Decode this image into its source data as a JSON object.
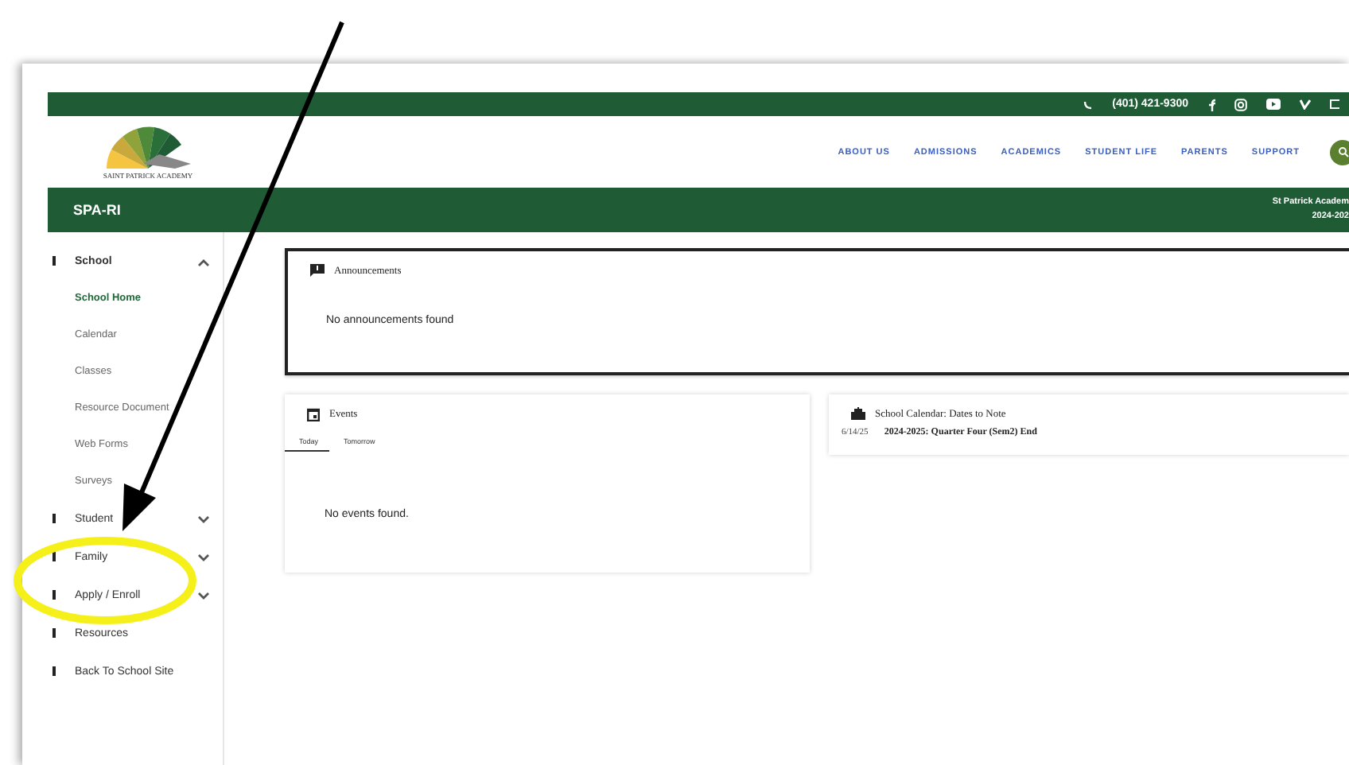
{
  "top_bar": {
    "phone": "(401) 421-9300"
  },
  "header": {
    "logo_text": "SAINT PATRICK ACADEMY",
    "nav": [
      "ABOUT US",
      "ADMISSIONS",
      "ACADEMICS",
      "STUDENT LIFE",
      "PARENTS",
      "SUPPORT"
    ]
  },
  "title_bar": {
    "title": "SPA-RI",
    "school": "St Patrick Academ",
    "year": "2024-202"
  },
  "sidebar": {
    "items": [
      {
        "label": "School",
        "kind": "section",
        "expanded": true,
        "children": [
          {
            "label": "School Home",
            "selected": true
          },
          {
            "label": "Calendar",
            "selected": false
          },
          {
            "label": "Classes",
            "selected": false
          },
          {
            "label": "Resource Document",
            "selected": false
          },
          {
            "label": "Web Forms",
            "selected": false
          },
          {
            "label": "Surveys",
            "selected": false
          }
        ]
      },
      {
        "label": "Student",
        "kind": "section",
        "expanded": false
      },
      {
        "label": "Family",
        "kind": "section",
        "expanded": false
      },
      {
        "label": "Apply / Enroll",
        "kind": "section",
        "expanded": false
      },
      {
        "label": "Resources",
        "kind": "link"
      },
      {
        "label": "Back To School Site",
        "kind": "link"
      }
    ]
  },
  "announcements": {
    "title": "Announcements",
    "message": "No announcements found"
  },
  "events": {
    "title": "Events",
    "tabs": [
      {
        "label": "Today",
        "selected": true
      },
      {
        "label": "Tomorrow",
        "selected": false
      }
    ],
    "message": "No events found."
  },
  "school_calendar": {
    "title": "School Calendar: Dates to Note",
    "entries": [
      {
        "date": "6/14/25",
        "text": "2024-2025: Quarter Four (Sem2) End"
      }
    ]
  }
}
